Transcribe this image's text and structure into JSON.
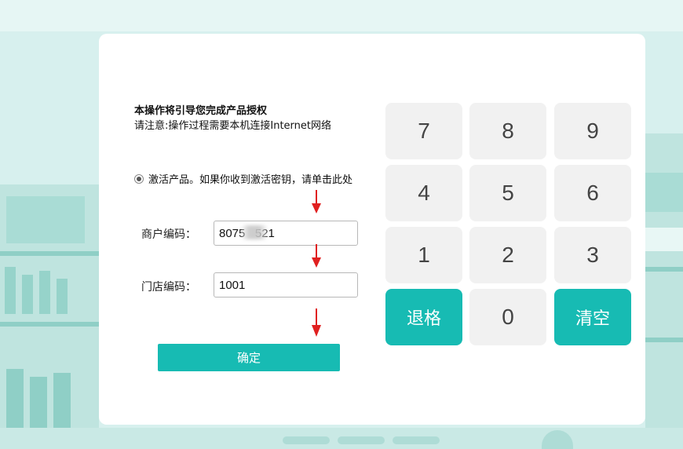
{
  "activation": {
    "title": "本操作将引导您完成产品授权",
    "notice": "请注意:操作过程需要本机连接Internet网络",
    "option_label": "激活产品。如果你收到激活密钥，请单击此处"
  },
  "form": {
    "merchant_label": "商户编码：",
    "merchant_value": "8075   521",
    "store_label": "门店编码：",
    "store_value": "1001",
    "confirm_label": "确定"
  },
  "keypad": {
    "keys": [
      "7",
      "8",
      "9",
      "4",
      "5",
      "6",
      "1",
      "2",
      "3"
    ],
    "backspace": "退格",
    "zero": "0",
    "clear": "清空"
  },
  "colors": {
    "accent": "#17bbb3",
    "arrow": "#e02020",
    "background": "#d7f0ee"
  }
}
